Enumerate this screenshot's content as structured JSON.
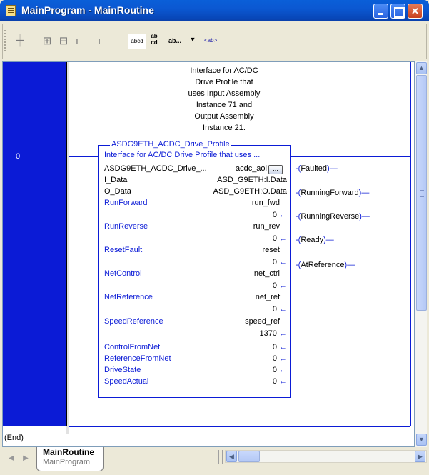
{
  "window": {
    "title": "MainProgram - MainRoutine"
  },
  "toolbar": {
    "box1": "abcd",
    "stack_top": "ab",
    "stack_bottom": "cd",
    "dropdown": "ab...",
    "tag_ab": "<ab>"
  },
  "rung": {
    "number": "0",
    "end_label": "(End)",
    "comment": "Interface for AC/DC\nDrive Profile that\nuses Input Assembly\nInstance 71 and\nOutput Assembly\nInstance 21."
  },
  "aoi": {
    "name": "ASDG9ETH_ACDC_Drive_Profile",
    "description": "Interface for AC/DC Drive Profile that uses ...",
    "instance_row": {
      "name": "ASDG9ETH_ACDC_Drive_...",
      "tag": "acdc_aoi"
    },
    "params": [
      {
        "name": "I_Data",
        "tag": "ASD_G9ETH:I.Data",
        "value": ""
      },
      {
        "name": "O_Data",
        "tag": "ASD_G9ETH:O.Data",
        "value": ""
      },
      {
        "name": "RunForward",
        "tag": "run_fwd",
        "value": "0"
      },
      {
        "name": "RunReverse",
        "tag": "run_rev",
        "value": "0"
      },
      {
        "name": "ResetFault",
        "tag": "reset",
        "value": "0"
      },
      {
        "name": "NetControl",
        "tag": "net_ctrl",
        "value": "0"
      },
      {
        "name": "NetReference",
        "tag": "net_ref",
        "value": "0"
      },
      {
        "name": "SpeedReference",
        "tag": "speed_ref",
        "value": "1370"
      },
      {
        "name": "ControlFromNet",
        "tag": "",
        "value": "0"
      },
      {
        "name": "ReferenceFromNet",
        "tag": "",
        "value": "0"
      },
      {
        "name": "DriveState",
        "tag": "",
        "value": "0"
      },
      {
        "name": "SpeedActual",
        "tag": "",
        "value": "0"
      }
    ],
    "arrow": "←",
    "ellipsis": "..."
  },
  "outputs": [
    "Faulted",
    "RunningForward",
    "RunningReverse",
    "Ready",
    "AtReference"
  ],
  "tabs": {
    "main": "MainRoutine",
    "sub": "MainProgram"
  },
  "icons": {
    "title": "routine-icon",
    "minimize": "minimize-icon",
    "maximize": "maximize-icon",
    "close": "close-icon"
  }
}
